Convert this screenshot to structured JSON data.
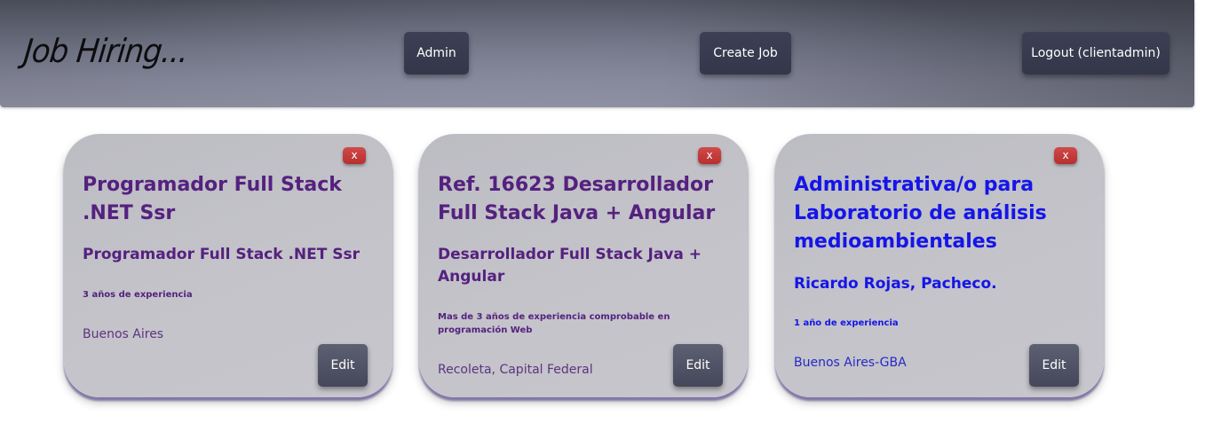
{
  "header": {
    "logo": "Job Hiring...",
    "admin_label": "Admin",
    "create_job_label": "Create Job",
    "logout_label": "Logout (clientadmin)"
  },
  "colors": {
    "title_purple": "#55217f",
    "title_blue": "#1515e8",
    "close_red": "#c43c3c"
  },
  "cards": [
    {
      "close_label": "x",
      "title": "Programador Full Stack .NET Ssr",
      "subtitle": "Programador Full Stack .NET Ssr",
      "experience": "3 años de experiencia",
      "location": "Buenos Aires",
      "edit_label": "Edit"
    },
    {
      "close_label": "x",
      "title": "Ref. 16623 Desarrollador Full Stack Java + Angular",
      "subtitle": "Desarrollador Full Stack Java + Angular",
      "experience": "Mas de 3 años de experiencia comprobable en programación Web",
      "location": "Recoleta, Capital Federal",
      "edit_label": "Edit"
    },
    {
      "close_label": "x",
      "title": "Administrativa/o para Laboratorio de análisis medioambientales",
      "subtitle": "Ricardo Rojas, Pacheco.",
      "experience": "1 año de experiencia",
      "location": "Buenos Aires-GBA",
      "edit_label": "Edit"
    }
  ]
}
